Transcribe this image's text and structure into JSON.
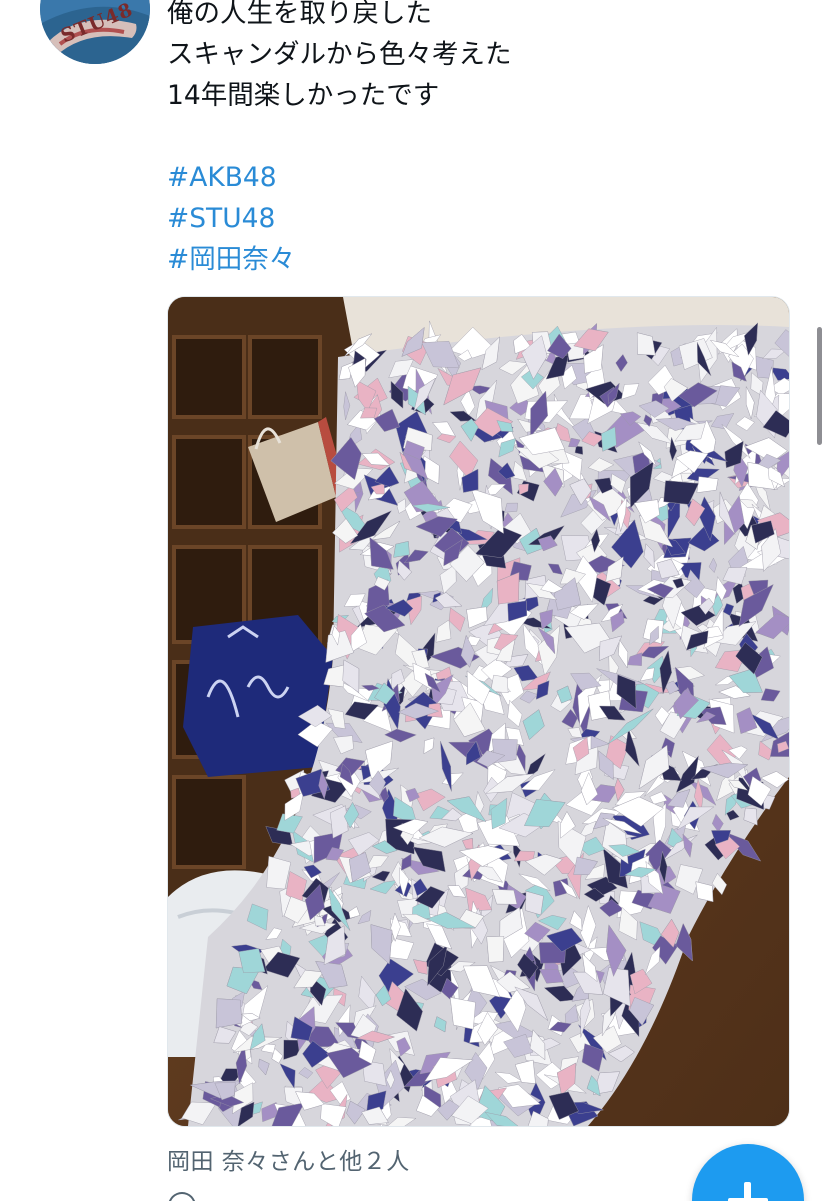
{
  "tweet": {
    "avatar_text": "STU48",
    "lines": [
      "俺の人生を取り戻した",
      "スキャンダルから色々考えた",
      "14年間楽しかったです"
    ],
    "hashtags": [
      "#AKB48",
      "#STU48",
      "#岡田奈々"
    ],
    "media_description": "photo-of-torn-paper-pieces-on-floor",
    "liked_by": "岡田 奈々さんと他２人"
  },
  "icons": {
    "compose": "plus-icon",
    "reply": "reply-icon"
  },
  "colors": {
    "text": "#0f1419",
    "hashtag": "#2a8bd6",
    "secondary": "#536471",
    "accent": "#1d9bf0"
  }
}
